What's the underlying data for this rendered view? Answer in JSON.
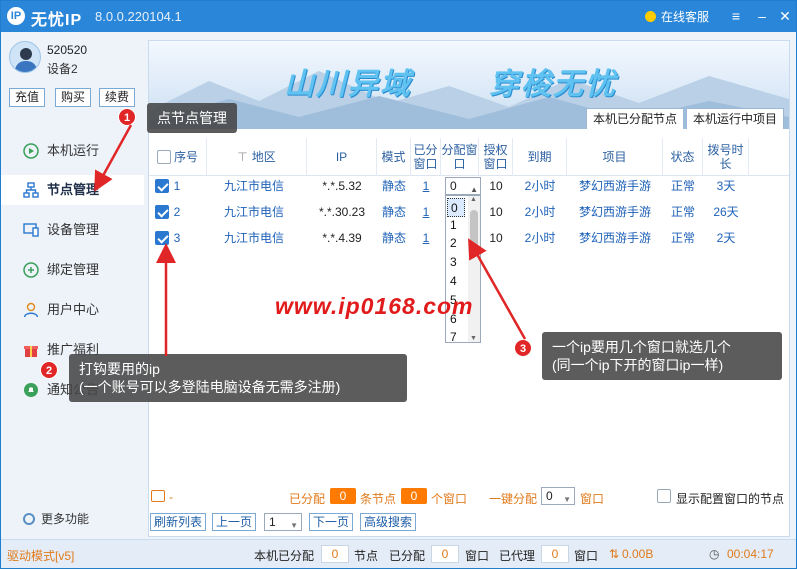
{
  "titlebar": {
    "app_name": "无忧IP",
    "version": "8.0.0.220104.1",
    "customer_service": "在线客服",
    "menu_icon": "menu-icon",
    "min_icon": "minimize-icon",
    "close_icon": "close-icon"
  },
  "sidebar": {
    "username": "520520",
    "device": "设备2",
    "buttons": [
      "充值",
      "购买",
      "续费"
    ],
    "items": [
      {
        "label": "本机运行",
        "icon": "play-icon",
        "active": false
      },
      {
        "label": "节点管理",
        "icon": "node-tree-icon",
        "active": true
      },
      {
        "label": "设备管理",
        "icon": "device-icon",
        "active": false
      },
      {
        "label": "绑定管理",
        "icon": "bind-icon",
        "active": false
      },
      {
        "label": "用户中心",
        "icon": "user-icon",
        "active": false
      },
      {
        "label": "推广福利",
        "icon": "gift-icon",
        "active": false
      },
      {
        "label": "通知公告",
        "icon": "bell-icon",
        "active": false
      }
    ],
    "more": "更多功能"
  },
  "banner": {
    "text_left": "山川异域",
    "text_right": "穿梭无忧",
    "tabs": [
      "本机已分配节点",
      "本机运行中项目"
    ]
  },
  "table": {
    "headers": [
      "序号",
      "地区",
      "IP",
      "模式",
      "已分窗口",
      "分配窗口",
      "授权窗口",
      "到期",
      "项目",
      "状态",
      "拨号时长"
    ],
    "rows": [
      {
        "no": "1",
        "region": "九江市电信",
        "ip": "*.*.5.32",
        "mode": "静态",
        "assigned": "1",
        "auth": "10",
        "expire": "2小时",
        "project": "梦幻西游手游",
        "status": "正常",
        "dial": "3天",
        "checked": true
      },
      {
        "no": "2",
        "region": "九江市电信",
        "ip": "*.*.30.23",
        "mode": "静态",
        "assigned": "1",
        "auth": "10",
        "expire": "2小时",
        "project": "梦幻西游手游",
        "status": "正常",
        "dial": "26天",
        "checked": true
      },
      {
        "no": "3",
        "region": "九江市电信",
        "ip": "*.*.4.39",
        "mode": "静态",
        "assigned": "1",
        "auth": "10",
        "expire": "2小时",
        "project": "梦幻西游手游",
        "status": "正常",
        "dial": "2天",
        "checked": true
      }
    ]
  },
  "dropdown": {
    "current": "0",
    "options": [
      "0",
      "1",
      "2",
      "3",
      "4",
      "5",
      "6",
      "7"
    ],
    "selected": "0"
  },
  "watermark": "www.ip0168.com",
  "callouts": {
    "c1_num": "1",
    "c1": "点节点管理",
    "c2_num": "2",
    "c2_line1": "打钩要用的ip",
    "c2_line2": "(一个账号可以多登陆电脑设备无需多注册)",
    "c3_num": "3",
    "c3_line1": "一个ip要用几个窗口就选几个",
    "c3_line2": "(同一个ip下开的窗口ip一样)"
  },
  "status_strip": {
    "note": "-",
    "assigned_label": "已分配",
    "assigned_nodes": "0",
    "nodes_unit": "条节点",
    "assigned_windows": "0",
    "windows_unit": "个窗口",
    "one_click_label": "一键分配",
    "one_click_value": "0",
    "one_click_unit": "窗口",
    "show_config_label": "显示配置窗口的节点"
  },
  "pager": {
    "refresh": "刷新列表",
    "prev": "上一页",
    "page": "1",
    "next": "下一页",
    "advanced": "高级搜索"
  },
  "footer": {
    "driver_mode": "驱动模式[v5]",
    "local_assigned_label": "本机已分配",
    "local_nodes": "0",
    "nodes_unit": "节点",
    "assigned_label": "已分配",
    "assigned_windows": "0",
    "window_unit": "窗口",
    "proxied_label": "已代理",
    "proxied_windows": "0",
    "window_unit2": "窗口",
    "traffic": "0.00B",
    "timer": "00:04:17"
  }
}
